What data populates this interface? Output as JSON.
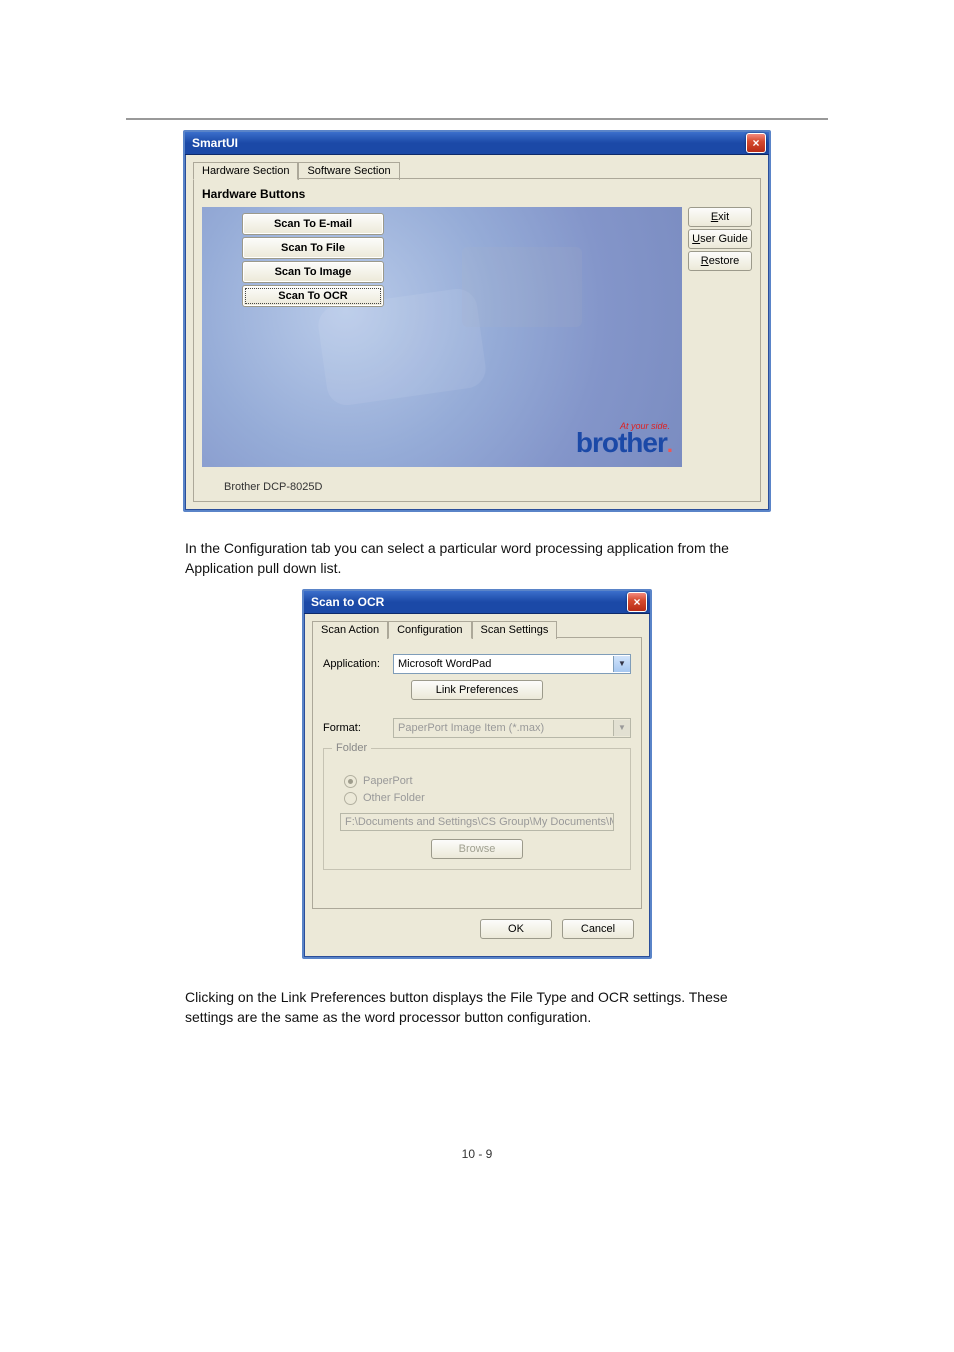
{
  "page": {
    "header_rule": true,
    "footer_page_number": "10 - 9"
  },
  "dialog1": {
    "title": "SmartUI",
    "tabs": [
      "Hardware Section",
      "Software Section"
    ],
    "active_tab_index": 0,
    "section_header": "Hardware Buttons",
    "buttons": [
      {
        "label": "Scan To E-mail",
        "focused": false
      },
      {
        "label": "Scan To File",
        "focused": false
      },
      {
        "label": "Scan To Image",
        "focused": false
      },
      {
        "label": "Scan To OCR",
        "focused": true
      }
    ],
    "side_buttons": [
      {
        "label_pre": "",
        "underlined": "E",
        "label_post": "xit"
      },
      {
        "label_pre": "",
        "underlined": "U",
        "label_post": "ser Guide"
      },
      {
        "label_pre": "",
        "underlined": "R",
        "label_post": "estore"
      }
    ],
    "brother_tag": "At your side.",
    "brother_logo": "brother",
    "device_label": "Brother DCP-8025D"
  },
  "mid_paragraph": "In the Configuration tab you can select a particular word processing application from the Application pull down list.",
  "dialog2": {
    "title": "Scan to OCR",
    "tabs": [
      "Scan Action",
      "Configuration",
      "Scan Settings"
    ],
    "active_tab_index": 1,
    "application_label": "Application:",
    "application_value": "Microsoft WordPad",
    "link_prefs_btn": "Link Preferences",
    "format_label": "Format:",
    "format_value": "PaperPort Image Item (*.max)",
    "folder_legend": "Folder",
    "radio_paperport": "PaperPort",
    "radio_other": "Other Folder",
    "path_value": "F:\\Documents and Settings\\CS Group\\My Documents\\My P",
    "browse_btn": "Browse",
    "ok_btn": "OK",
    "cancel_btn": "Cancel"
  },
  "bottom_paragraph": "Clicking on the Link Preferences button displays the File Type and OCR settings. These settings are the same as the word processor button configuration.",
  "icons": {
    "close": "×",
    "dropdown": "▼"
  }
}
